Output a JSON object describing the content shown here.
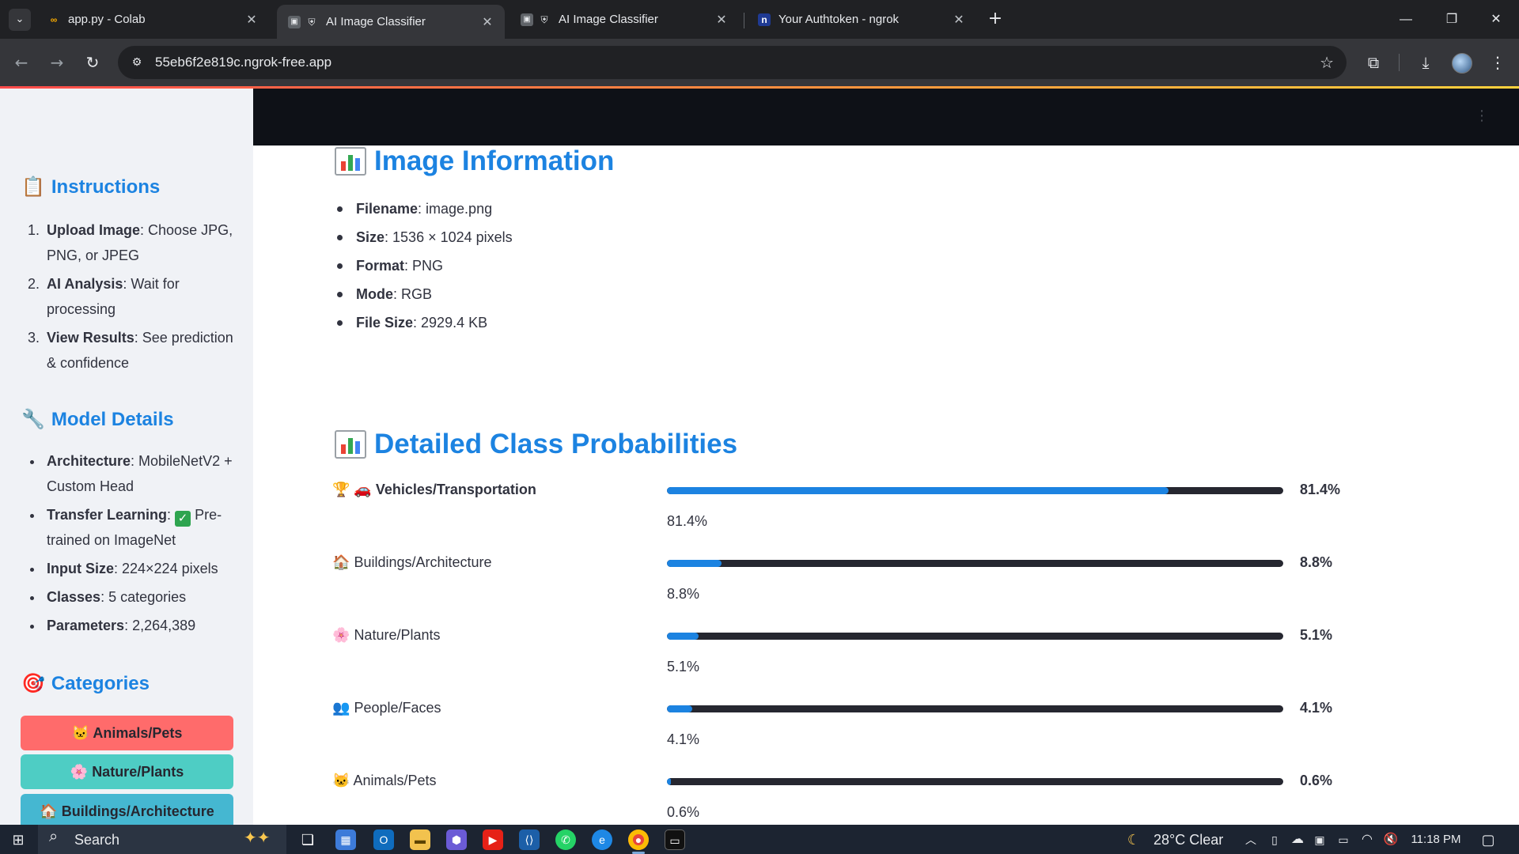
{
  "browser": {
    "tabs": [
      {
        "title": "app.py - Colab",
        "favicon": "colab-icon"
      },
      {
        "title": "AI Image Classifier",
        "favicon": "shield-icon"
      },
      {
        "title": "AI Image Classifier",
        "favicon": "shield-icon"
      },
      {
        "title": "Your Authtoken - ngrok",
        "favicon": "ngrok-icon"
      }
    ],
    "url": "55eb6f2e819c.ngrok-free.app"
  },
  "sidebar": {
    "instructions": {
      "title": "Instructions",
      "items": [
        {
          "bold": "Upload Image",
          "text": ": Choose JPG, PNG, or JPEG"
        },
        {
          "bold": "AI Analysis",
          "text": ": Wait for processing"
        },
        {
          "bold": "View Results",
          "text": ": See prediction & confidence"
        }
      ]
    },
    "model_details": {
      "title": "Model Details",
      "items": [
        {
          "bold": "Architecture",
          "text": ": MobileNetV2 + Custom Head"
        },
        {
          "bold": "Transfer Learning",
          "text": " Pre-trained on ImageNet"
        },
        {
          "bold": "Input Size",
          "text": ": 224×224 pixels"
        },
        {
          "bold": "Classes",
          "text": ": 5 categories"
        },
        {
          "bold": "Parameters",
          "text": ": 2,264,389"
        }
      ]
    },
    "categories": {
      "title": "Categories",
      "items": [
        {
          "emoji": "🐱",
          "label": "Animals/Pets",
          "color": "#ff6b6b"
        },
        {
          "emoji": "🌸",
          "label": "Nature/Plants",
          "color": "#4ecdc4"
        },
        {
          "emoji": "🏠",
          "label": "Buildings/Architecture",
          "color": "#45b7d1"
        }
      ]
    }
  },
  "main": {
    "image_info": {
      "title": "Image Information",
      "items": [
        {
          "bold": "Filename",
          "text": ": image.png"
        },
        {
          "bold": "Size",
          "text": ": 1536 × 1024 pixels"
        },
        {
          "bold": "Format",
          "text": ": PNG"
        },
        {
          "bold": "Mode",
          "text": ": RGB"
        },
        {
          "bold": "File Size",
          "text": ": 2929.4 KB"
        }
      ]
    },
    "probabilities": {
      "title": "Detailed Class Probabilities",
      "rows": [
        {
          "prefix": "🏆 🚗",
          "label": "Vehicles/Transportation",
          "value": 0.814,
          "percent": "81.4%",
          "caption": "81.4%",
          "top": true
        },
        {
          "prefix": "🏠",
          "label": "Buildings/Architecture",
          "value": 0.088,
          "percent": "8.8%",
          "caption": "8.8%",
          "top": false
        },
        {
          "prefix": "🌸",
          "label": "Nature/Plants",
          "value": 0.051,
          "percent": "5.1%",
          "caption": "5.1%",
          "top": false
        },
        {
          "prefix": "👥",
          "label": "People/Faces",
          "value": 0.041,
          "percent": "4.1%",
          "caption": "4.1%",
          "top": false
        },
        {
          "prefix": "🐱",
          "label": "Animals/Pets",
          "value": 0.006,
          "percent": "0.6%",
          "caption": "0.6%",
          "top": false
        }
      ]
    }
  },
  "taskbar": {
    "search_label": "Search",
    "weather": "28°C  Clear",
    "time": "11:18 PM"
  },
  "colors": {
    "accent": "#1c83e1",
    "bar_track": "#262730",
    "header_dark": "#0e1117"
  }
}
